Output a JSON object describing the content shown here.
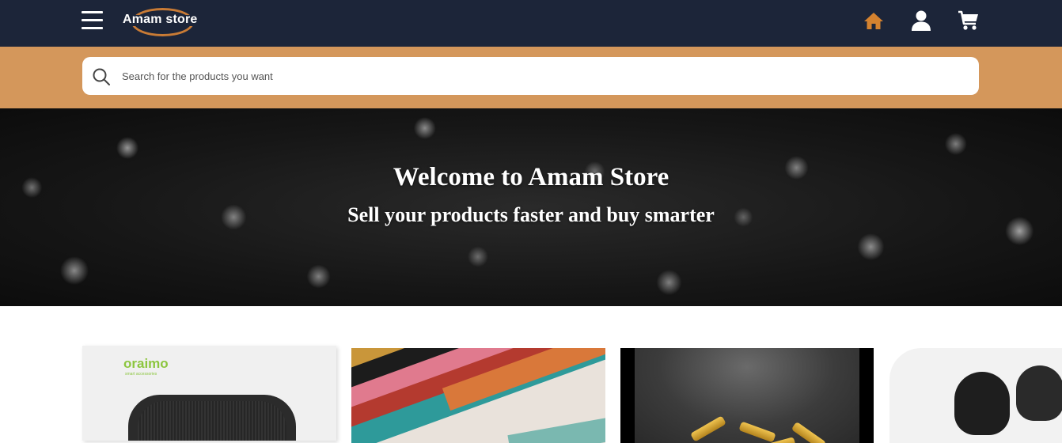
{
  "header": {
    "logo_text": "Amam store",
    "menu_icon": "hamburger-menu-icon",
    "nav_icons": [
      "home-icon",
      "user-icon",
      "cart-icon"
    ],
    "accent_color": "#d4975b",
    "bar_color": "#1c2539",
    "home_color": "#d4822f"
  },
  "search": {
    "placeholder": "Search for the products you want",
    "value": ""
  },
  "hero": {
    "title": "Welcome to Amam Store",
    "subtitle": "Sell your products faster and buy smarter"
  },
  "products": {
    "cards": [
      {
        "brand": "oraimo",
        "brand_sub": "smart accessories",
        "image": "bluetooth-speaker"
      },
      {
        "image": "colored-scarves"
      },
      {
        "image": "gold-cufflinks"
      },
      {
        "image": "wireless-earbuds"
      }
    ]
  }
}
